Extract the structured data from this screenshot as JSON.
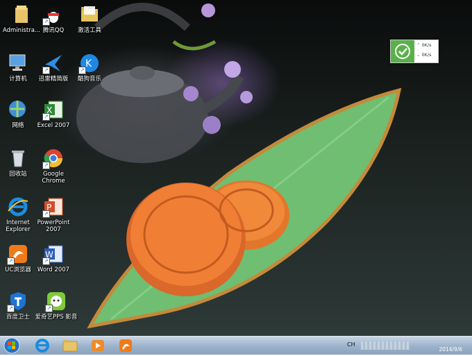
{
  "desktop_icons": [
    {
      "label": "Administra..."
    },
    {
      "label": "腾讯QQ"
    },
    {
      "label": "激活工具"
    },
    {
      "label": "计算机"
    },
    {
      "label": "迅雷精简版"
    },
    {
      "label": "酷狗音乐"
    },
    {
      "label": "网络"
    },
    {
      "label": "Excel 2007"
    },
    {
      "label": "回收站"
    },
    {
      "label": "Google Chrome"
    },
    {
      "label": "Internet Explorer"
    },
    {
      "label": "PowerPoint 2007"
    },
    {
      "label": "UC浏览器"
    },
    {
      "label": "Word 2007"
    },
    {
      "label": "百度卫士"
    },
    {
      "label": "爱奇艺PPS 影音"
    }
  ],
  "net_widget": {
    "up_rate": "0K/s",
    "down_rate": "0K/s",
    "accent": "#5ab04a"
  },
  "taskbar": {
    "pinned": [
      "start-orb-icon",
      "ie-icon",
      "explorer-folder-icon",
      "media-player-icon",
      "uc-browser-icon"
    ],
    "ime_label": "CH",
    "clock_date": "2014/9/6"
  }
}
